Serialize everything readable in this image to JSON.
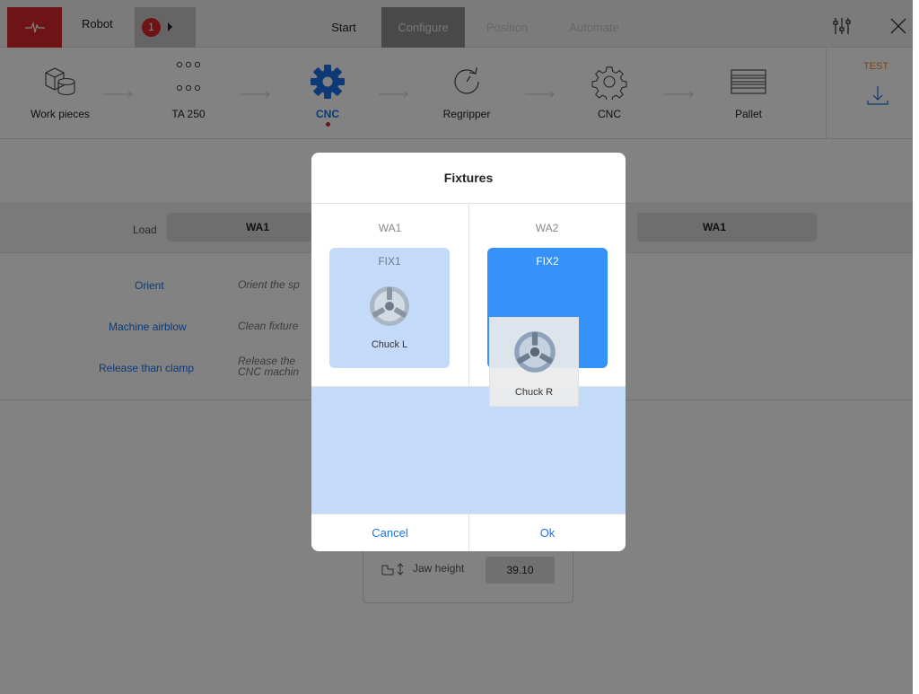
{
  "topbar": {
    "robot_label": "Robot",
    "robot_badge_count": "1",
    "tabs": [
      {
        "label": "Start"
      },
      {
        "label": "Configure"
      },
      {
        "label": "Position"
      },
      {
        "label": "Automate"
      }
    ]
  },
  "steps": [
    {
      "label": "Work pieces",
      "icon": "workpieces-icon"
    },
    {
      "label": "TA 250",
      "icon": "ta250-grid-icon"
    },
    {
      "label": "CNC",
      "icon": "gear-icon",
      "active": true
    },
    {
      "label": "Regripper",
      "icon": "rotate-icon"
    },
    {
      "label": "CNC",
      "icon": "gear-outline-icon"
    },
    {
      "label": "Pallet",
      "icon": "pallet-icon"
    }
  ],
  "test": {
    "label": "TEST",
    "icon": "download-icon"
  },
  "load": {
    "label": "Load",
    "left_value": "WA1",
    "right_value": "WA1"
  },
  "actions": [
    {
      "name": "Orient",
      "desc": "Orient the sp"
    },
    {
      "name": "Machine airblow",
      "desc": "Clean fixture"
    },
    {
      "name": "Release than clamp",
      "desc": "Release the\nCNC machin"
    }
  ],
  "jaw": {
    "label": "Jaw height",
    "value": "39.10"
  },
  "dialog": {
    "title": "Fixtures",
    "columns": [
      {
        "label": "WA1",
        "fixture": "FIX1",
        "chuck": "Chuck L"
      },
      {
        "label": "WA2",
        "fixture": "FIX2"
      }
    ],
    "dragging_chuck": "Chuck R",
    "cancel_label": "Cancel",
    "ok_label": "Ok"
  },
  "colors": {
    "accent": "#1a73e8",
    "brand_red": "#d8262c",
    "selected_fixture": "#3592f8",
    "fixture_light": "#c3dbf8",
    "test_orange": "#f08c2c"
  }
}
